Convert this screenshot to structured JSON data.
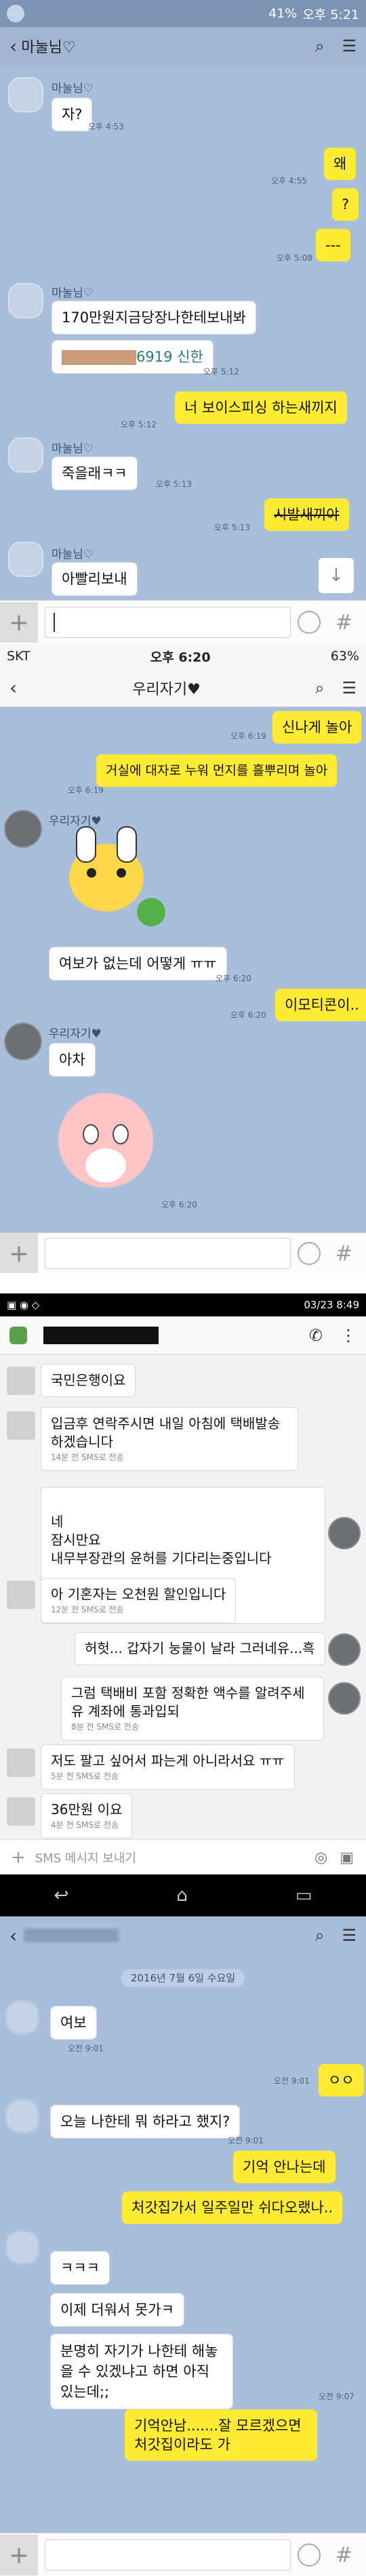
{
  "panel1": {
    "status_left": "",
    "status_time": "오후 5:21",
    "status_battery": "41%",
    "chat_title": "마눌님♡",
    "messages": [
      {
        "side": "in",
        "name": "마눌님♡",
        "text": "자?",
        "time": "오후 4:53"
      },
      {
        "side": "out",
        "text": "왜",
        "time": "오후 4:55"
      },
      {
        "side": "out",
        "text": "?",
        "time": ""
      },
      {
        "side": "out",
        "text": "---",
        "time": "오후 5:08"
      },
      {
        "side": "in",
        "name": "마눌님♡",
        "text": "170만원지금당장나한테보내봐",
        "time": ""
      },
      {
        "side": "in",
        "text": "6919 신한",
        "time": "오후 5:12"
      },
      {
        "side": "out",
        "text": "너 보이스피싱 하는새끼지",
        "time": "오후 5:12"
      },
      {
        "side": "in",
        "name": "마눌님♡",
        "text": "죽을래ㅋㅋ",
        "time": "오후 5:13"
      },
      {
        "side": "out",
        "text": "시발새끼야",
        "time": "오후 5:13"
      },
      {
        "side": "in",
        "name": "마눌님♡",
        "text": "아빨리보내",
        "time": ""
      }
    ],
    "input_hash": "#"
  },
  "panel2": {
    "carrier": "SKT",
    "status_time": "오후 6:20",
    "battery": "63%",
    "chat_title": "우리자기♥",
    "messages": [
      {
        "side": "out",
        "text": "신나게 놀아",
        "time": "오후 6:19"
      },
      {
        "side": "out",
        "text": "거실에 대자로 누워 먼지를 흘뿌리며 놀아",
        "time": "오후 6:19"
      },
      {
        "side": "in",
        "name": "우리자기♥",
        "text": "",
        "time": ""
      },
      {
        "side": "in",
        "text": "여보가 없는데 어떻게 ㅠㅠ",
        "time": "오후 6:20"
      },
      {
        "side": "out",
        "text": "이모티콘이..",
        "time": "오후 6:20"
      },
      {
        "side": "in",
        "name": "우리자기♥",
        "text": "아차",
        "time": ""
      },
      {
        "side": "in",
        "text": "",
        "time": "오후 6:20"
      }
    ],
    "input_hash": "#"
  },
  "panel3": {
    "status_time": "03/23 8:49",
    "messages": [
      {
        "side": "in",
        "text": "국민은행이요",
        "meta": ""
      },
      {
        "side": "in",
        "text": "입금후 연락주시면 내일 아침에 택배발송하겠습니다",
        "meta": "14분 전 SMS로 전송"
      },
      {
        "side": "out",
        "text": "네\n잠시만요\n내무부장관의 윤허를 기다리는중입니다",
        "meta": "13분 전 SMS로 전송"
      },
      {
        "side": "in",
        "text": "아 기혼자는 오천원 할인입니다",
        "meta": "12분 전 SMS로 전송"
      },
      {
        "side": "out",
        "text": "허헛... 갑자기 눙물이 날라 그러네유...흑",
        "meta": ""
      },
      {
        "side": "out",
        "text": "그럼 택배비 포함 정확한 액수를 알려주세유 계좌에 통과입되",
        "meta": "8분 전 SMS로 전송"
      },
      {
        "side": "in",
        "text": "저도 팔고 싶어서 파는게 아니라서요 ㅠㅠ",
        "meta": "5분 전 SMS로 전송"
      },
      {
        "side": "in",
        "text": "36만원 이요",
        "meta": "4분 전 SMS로 전송"
      }
    ],
    "input_placeholder": "SMS 메시지 보내기"
  },
  "panel4": {
    "date": "2016년 7월 6일 수요일",
    "messages": [
      {
        "side": "in",
        "text": "여보",
        "time": "오전 9:01"
      },
      {
        "side": "out",
        "text": "ㅇㅇ",
        "time": "오전 9:01"
      },
      {
        "side": "in",
        "text": "오늘 나한테 뭐 하라고 했지?",
        "time": "오전 9:01"
      },
      {
        "side": "out",
        "text": "기억 안나는데",
        "time": ""
      },
      {
        "side": "out",
        "text": "처갓집가서 일주일만 쉬다오랬나..",
        "time": ""
      },
      {
        "side": "in",
        "text": "ㅋㅋㅋ",
        "time": ""
      },
      {
        "side": "in",
        "text": "이제 더워서 못가ㅋ",
        "time": ""
      },
      {
        "side": "in",
        "text": "분명히 자기가 나한테 해놓을 수 있겠냐고 하면 아직 있는데;;",
        "time": "오전 9:07"
      },
      {
        "side": "out",
        "text": "기억안남.......잘 모르겠으면 처갓집이라도 가",
        "time": ""
      }
    ],
    "input_hash": "#"
  }
}
